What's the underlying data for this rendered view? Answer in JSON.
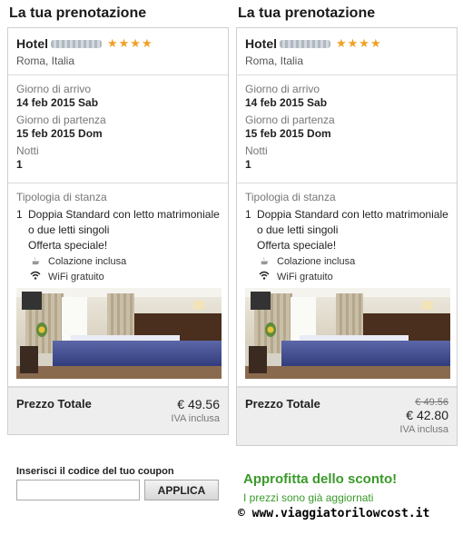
{
  "panels": [
    {
      "heading": "La tua prenotazione",
      "hotel": {
        "name": "Hotel",
        "stars": "★★★★",
        "city": "Roma, Italia"
      },
      "dates": {
        "arrival_label": "Giorno di arrivo",
        "arrival_value": "14 feb 2015 Sab",
        "departure_label": "Giorno di partenza",
        "departure_value": "15 feb 2015 Dom",
        "nights_label": "Notti",
        "nights_value": "1"
      },
      "room": {
        "type_label": "Tipologia di stanza",
        "qty": "1",
        "description": "Doppia Standard con letto matrimoniale o due letti singoli",
        "offer": "Offerta speciale!",
        "amenities": [
          "Colazione inclusa",
          "WiFi gratuito"
        ]
      },
      "total": {
        "label": "Prezzo Totale",
        "old_price": "",
        "price": "€ 49.56",
        "vat": "IVA inclusa"
      }
    },
    {
      "heading": "La tua prenotazione",
      "hotel": {
        "name": "Hotel",
        "stars": "★★★★",
        "city": "Roma, Italia"
      },
      "dates": {
        "arrival_label": "Giorno di arrivo",
        "arrival_value": "14 feb 2015 Sab",
        "departure_label": "Giorno di partenza",
        "departure_value": "15 feb 2015 Dom",
        "nights_label": "Notti",
        "nights_value": "1"
      },
      "room": {
        "type_label": "Tipologia di stanza",
        "qty": "1",
        "description": "Doppia Standard con letto matrimoniale o due letti singoli",
        "offer": "Offerta speciale!",
        "amenities": [
          "Colazione inclusa",
          "WiFi gratuito"
        ]
      },
      "total": {
        "label": "Prezzo Totale",
        "old_price": "€ 49.56",
        "price": "€ 42.80",
        "vat": "IVA inclusa"
      }
    }
  ],
  "coupon": {
    "label": "Inserisci il codice del tuo coupon",
    "input_value": "",
    "button_label": "APPLICA"
  },
  "promo": {
    "title": "Approfitta dello sconto!",
    "subtitle": "I prezzi sono già aggiornati"
  },
  "credit": "© www.viaggiatorilowcost.it",
  "icons": {
    "breakfast": "coffee-cup-icon",
    "wifi": "wifi-icon",
    "stars": "star-icon"
  },
  "colors": {
    "stars": "#f0a023",
    "promo": "#3a9a2a",
    "total_bg": "#eeeeee"
  }
}
